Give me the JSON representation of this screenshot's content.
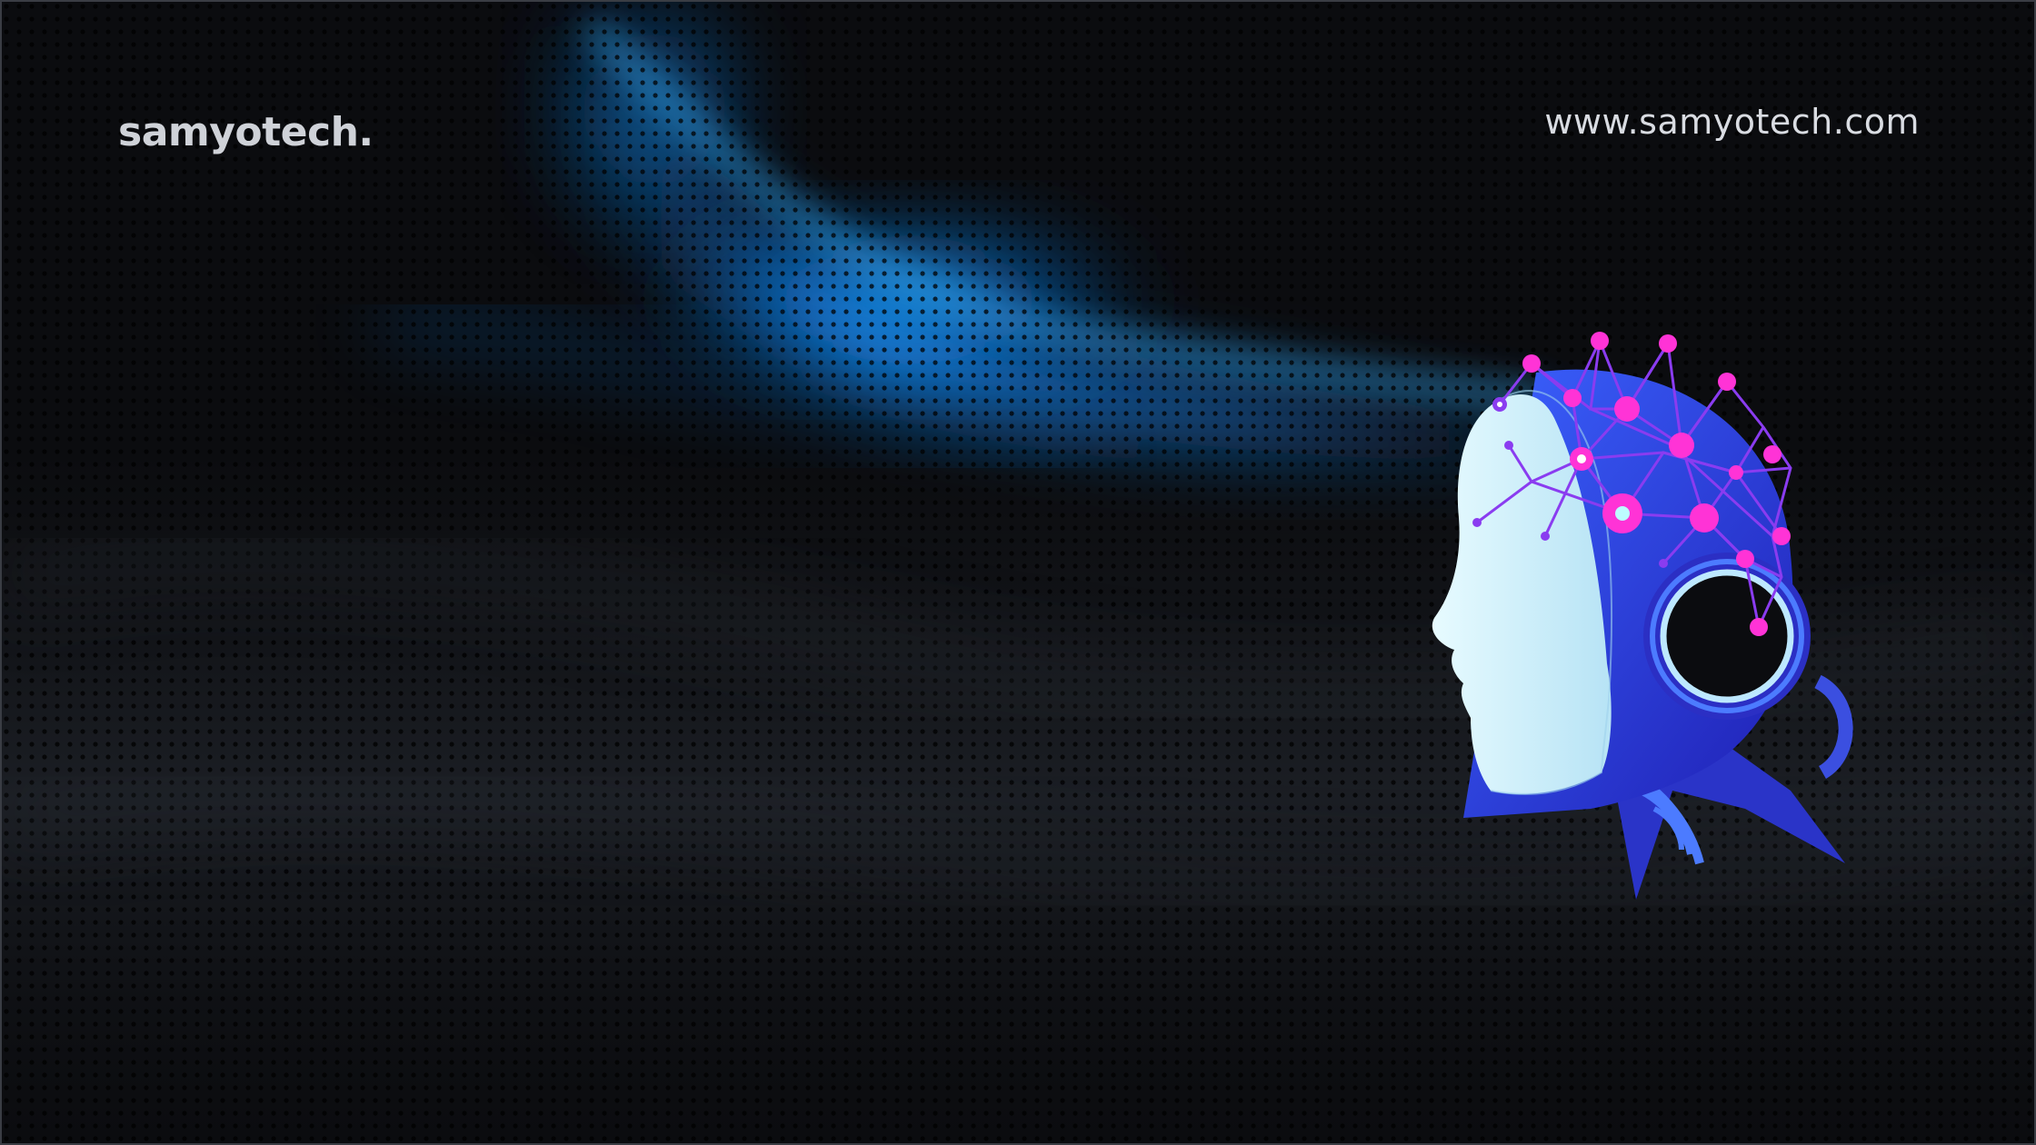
{
  "header": {
    "logo_text": "samyotech.",
    "website": "www.samyotech.com"
  },
  "illustration": {
    "subject": "ai-robot-head-with-neural-network",
    "background": "dotted-blue-wave-mesh"
  },
  "colors": {
    "background": "#0b0c0f",
    "wave_blue": "#1e9bff",
    "face_light": "#d9f3fb",
    "head_blue": "#2a3bd8",
    "network_purple": "#8a3cf0",
    "node_magenta": "#ff33d6"
  }
}
